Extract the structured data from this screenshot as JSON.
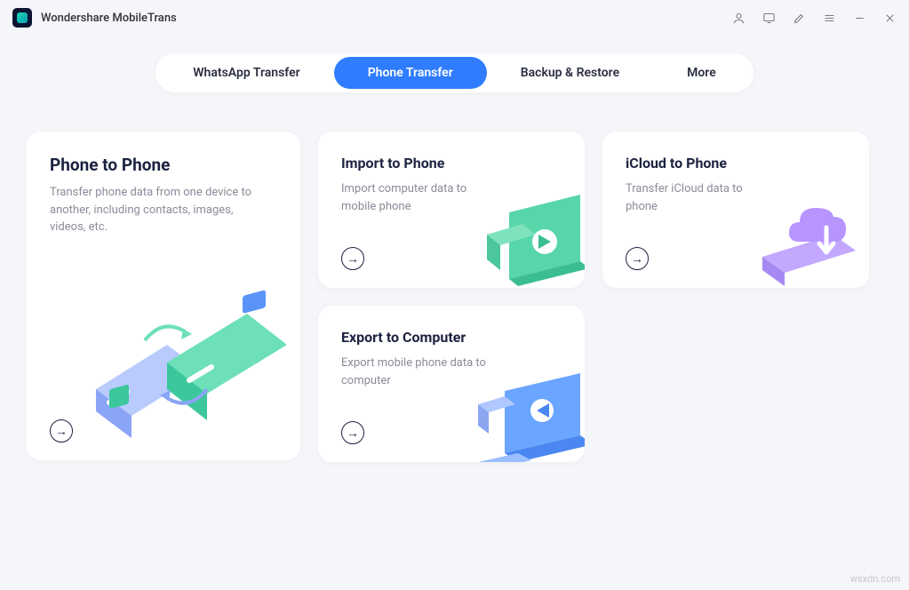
{
  "app": {
    "title": "Wondershare MobileTrans"
  },
  "tabs": [
    {
      "label": "WhatsApp Transfer",
      "active": false
    },
    {
      "label": "Phone Transfer",
      "active": true
    },
    {
      "label": "Backup & Restore",
      "active": false
    },
    {
      "label": "More",
      "active": false
    }
  ],
  "cards": {
    "phone_to_phone": {
      "title": "Phone to Phone",
      "desc": "Transfer phone data from one device to another, including contacts, images, videos, etc."
    },
    "import_to_phone": {
      "title": "Import to Phone",
      "desc": "Import computer data to mobile phone"
    },
    "icloud_to_phone": {
      "title": "iCloud to Phone",
      "desc": "Transfer iCloud data to phone"
    },
    "export_to_computer": {
      "title": "Export to Computer",
      "desc": "Export mobile phone data to computer"
    }
  },
  "watermark": "wsxdn.com"
}
